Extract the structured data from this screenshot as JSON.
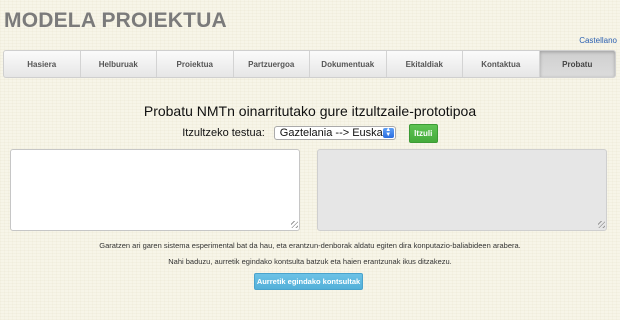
{
  "header": {
    "site_title": "MODELA PROIEKTUA",
    "language_link": "Castellano"
  },
  "nav": {
    "items": [
      {
        "label": "Hasiera"
      },
      {
        "label": "Helburuak"
      },
      {
        "label": "Proiektua"
      },
      {
        "label": "Partzuergoa"
      },
      {
        "label": "Dokumentuak"
      },
      {
        "label": "Ekitaldiak"
      },
      {
        "label": "Kontaktua"
      },
      {
        "label": "Probatu"
      }
    ],
    "active": "Probatu"
  },
  "translator": {
    "heading": "Probatu NMTn oinarritutako gure itzultzaile-prototipoa",
    "source_label": "Itzultzeko testua:",
    "language_pair": "Gaztelania --> Euskara",
    "translate_button": "Itzuli",
    "source_text": "",
    "output_text": ""
  },
  "notes": {
    "line1": "Garatzen ari garen sistema esperimental bat da hau, eta erantzun-denborak aldatu egiten dira konputazio-baliabideen arabera.",
    "line2": "Nahi baduzu, aurretik egindako kontsulta batzuk eta haien erantzunak ikus ditzakezu."
  },
  "history_button": "Aurretik egindako kontsultak",
  "colors": {
    "translate_button": "#4cb543",
    "history_button": "#5bb8e0",
    "link": "#2a5fb0"
  }
}
